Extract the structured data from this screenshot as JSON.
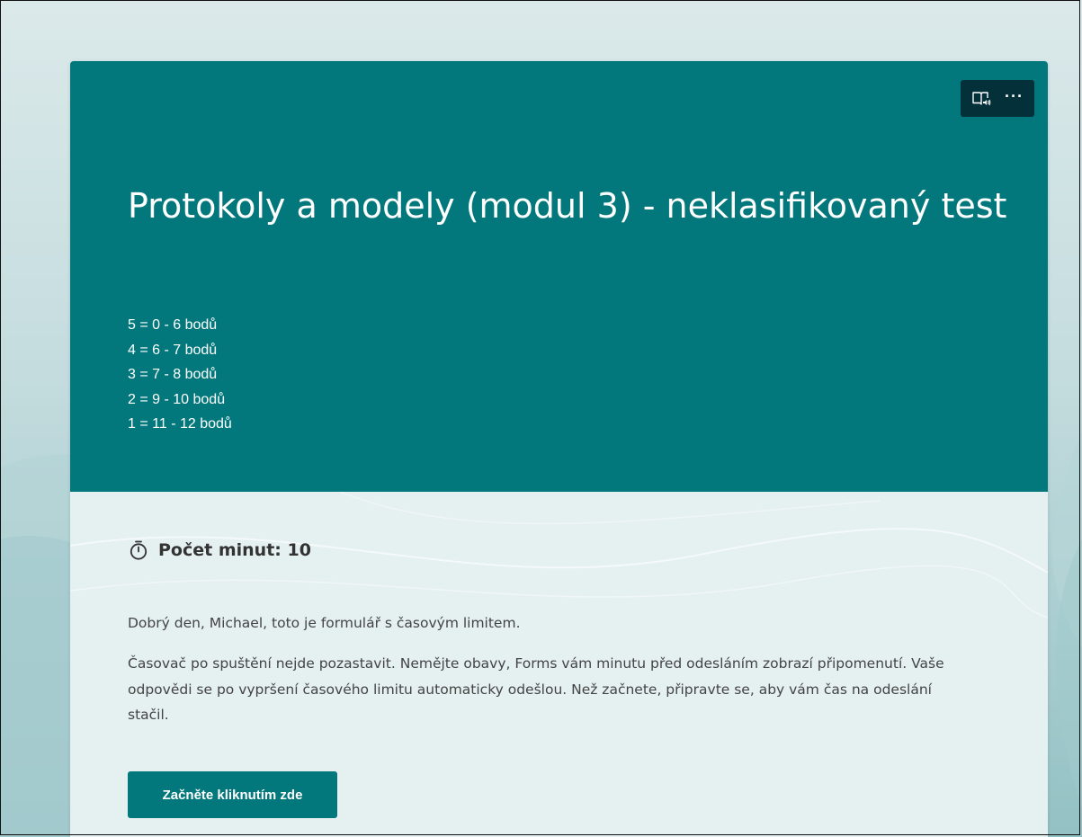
{
  "form": {
    "title": "Protokoly a modely (modul 3) - neklasifikovaný test",
    "grades": [
      "5 = 0 - 6 bodů",
      "4 = 6 - 7 bodů",
      "3 = 7 - 8 bodů",
      "2 = 9 - 10 bodů",
      "1 = 11 - 12 bodů"
    ],
    "timer_label": "Počet minut: 10",
    "greeting": "Dobrý den, Michael, toto je formulář s časovým limitem.",
    "info": "Časovač po spuštění nejde pozastavit. Nemějte obavy, Forms vám minutu před odesláním zobrazí připomenutí. Vaše odpovědi se po vypršení časového limitu automaticky odešlou. Než začnete, připravte se, aby vám čas na odeslání stačil.",
    "start_button": "Začněte kliknutím zde"
  },
  "toolbar": {
    "icons": [
      "immersive-reader-icon",
      "more-options-icon"
    ]
  },
  "colors": {
    "header": "#03787c",
    "toolbar": "#04303a",
    "content_bg": "#e5f0f0",
    "button": "#03787c"
  }
}
